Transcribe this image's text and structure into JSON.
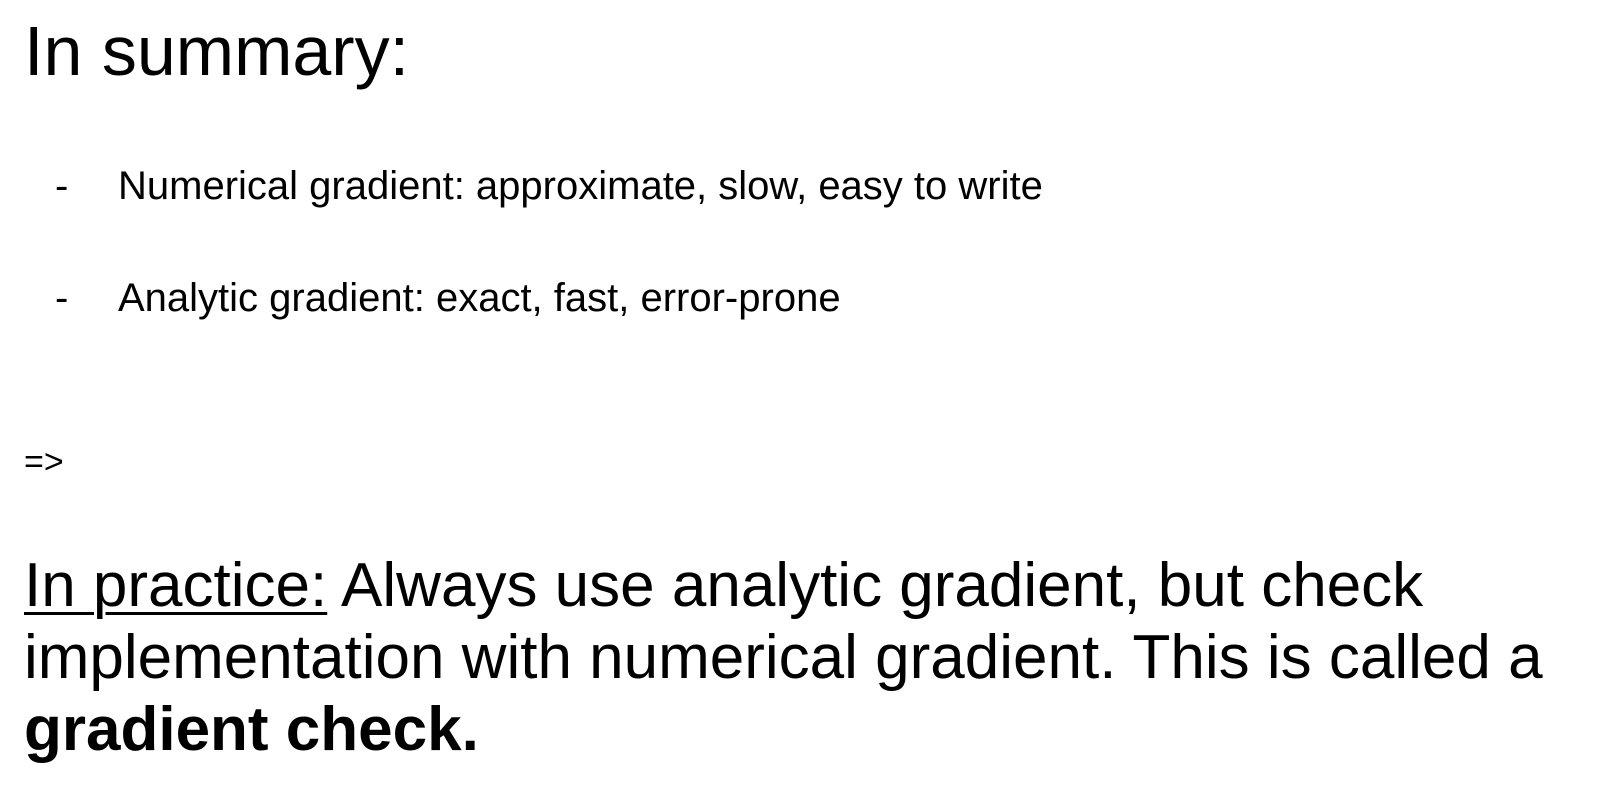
{
  "slide": {
    "title": "In summary:",
    "bullets": [
      {
        "marker": "-",
        "text": "Numerical gradient: approximate, slow, easy to write"
      },
      {
        "marker": "-",
        "text": "Analytic gradient: exact, fast, error-prone"
      }
    ],
    "arrow": "=>",
    "practice": {
      "lead": "In practice:",
      "line1_rest": " Always use analytic gradient, but check",
      "line2": "implementation with numerical gradient. This is called a",
      "emphasis": "gradient check."
    }
  }
}
